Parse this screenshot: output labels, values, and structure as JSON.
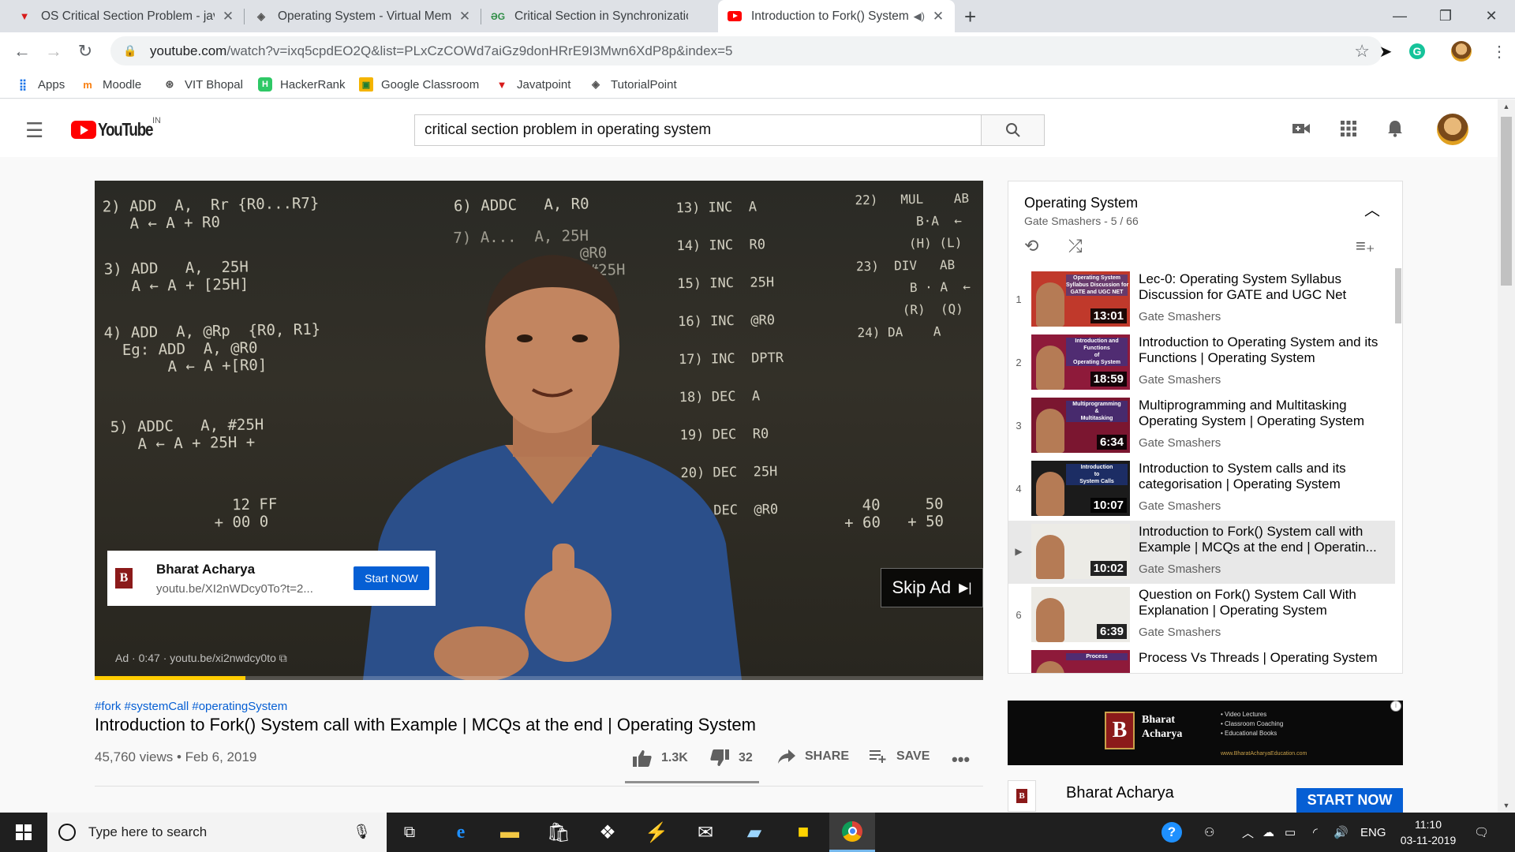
{
  "browser": {
    "tabs": [
      {
        "title": "OS Critical Section Problem - javatpoint",
        "favicon": "javatpoint-icon",
        "color": "#d81b1b"
      },
      {
        "title": "Operating System - Virtual Memory",
        "favicon": "tutorialspoint-icon",
        "color": "#555555"
      },
      {
        "title": "Critical Section in Synchronization",
        "favicon": "geeksforgeeks-icon",
        "color": "#2f8d46"
      },
      {
        "title": "Introduction to Fork() System call",
        "favicon": "youtube-icon",
        "color": "#ff0000",
        "active": true
      }
    ],
    "url_host": "youtube.com",
    "url_path": "/watch?v=ixq5cpdEO2Q&list=PLxCzCOWd7aiGz9donHRrE9I3Mwn6XdP8p&index=5",
    "bookmarks": [
      {
        "label": "Apps",
        "icon": "apps-grid-icon"
      },
      {
        "label": "Moodle",
        "icon": "moodle-icon"
      },
      {
        "label": "VIT Bhopal",
        "icon": "vit-icon"
      },
      {
        "label": "HackerRank",
        "icon": "hackerrank-icon"
      },
      {
        "label": "Google Classroom",
        "icon": "classroom-icon"
      },
      {
        "label": "Javatpoint",
        "icon": "javatpoint-icon"
      },
      {
        "label": "TutorialPoint",
        "icon": "tutorialspoint-icon"
      }
    ]
  },
  "youtube": {
    "logo_text": "YouTube",
    "country": "IN",
    "search_value": "critical section problem in operating system"
  },
  "player": {
    "chalkboard": [
      "2) ADD  A,  Rr {R0...R7}\n   A ← A + R0",
      "3) ADD   A,  25H\n   A ← A + [25H]",
      "4) ADD  A, @Rp  {R0, R1}\n  Eg: ADD  A, @R0\n       A ← A +[R0]",
      "5) ADDC   A, #25H\n   A ← A + 25H +",
      "   12 FF\n + 00 0",
      "6) ADDC   A, R0",
      "7) A...  A, 25H\n              @R0\n            A, #25H\n         25H - CF",
      "13) INC  A\n14) INC  R0\n15) INC  25H\n16) INC  @R0\n17) INC  DPTR\n18) DEC  A\n19) DEC  R0\n20) DEC  25H\n21) DEC  @R0",
      "22)   MUL    AB\n        B·A  ←\n       (H) (L)\n23)  DIV   AB\n       B · A  ←\n      (R)  (Q)\n24) DA    A",
      "  40     50\n+ 60   + 50"
    ],
    "ad_card": {
      "name": "Bharat Acharya",
      "link": "youtu.be/XI2nWDcy0To?t=2...",
      "button": "Start NOW"
    },
    "skip_label": "Skip Ad",
    "ad_bar": "Ad · 0:47 ·  youtu.be/xi2nwdcy0to",
    "progress": 0.17
  },
  "video": {
    "hashtags": "#fork #systemCall #operatingSystem",
    "title": "Introduction to Fork() System call with Example | MCQs at the end | Operating System",
    "stats": "45,760 views • Feb 6, 2019",
    "likes": "1.3K",
    "dislikes": "32",
    "share": "SHARE",
    "save": "SAVE"
  },
  "playlist": {
    "title": "Operating System",
    "subtitle": "Gate Smashers - 5 / 66",
    "items": [
      {
        "index": "1",
        "title": "Lec-0: Operating System Syllabus Discussion for GATE and UGC Net",
        "channel": "Gate Smashers",
        "duration": "13:01",
        "thumb_text": "Operating System\nSyllabus Discussion for\nGATE and UGC NET"
      },
      {
        "index": "2",
        "title": "Introduction to Operating System and its Functions | Operating System",
        "channel": "Gate Smashers",
        "duration": "18:59",
        "thumb_text": "Introduction and\nFunctions\nof\nOperating System"
      },
      {
        "index": "3",
        "title": "Multiprogramming and Multitasking Operating System | Operating System",
        "channel": "Gate Smashers",
        "duration": "6:34",
        "thumb_text": "Multiprogramming\n&\nMultitasking"
      },
      {
        "index": "4",
        "title": "Introduction to System calls and its categorisation | Operating System",
        "channel": "Gate Smashers",
        "duration": "10:07",
        "thumb_text": "Introduction\nto\nSystem Calls"
      },
      {
        "index": "▶",
        "title": "Introduction to Fork() System call with Example | MCQs at the end | Operatin...",
        "channel": "Gate Smashers",
        "duration": "10:02",
        "thumb_text": "",
        "current": true
      },
      {
        "index": "6",
        "title": "Question on Fork() System Call With Explanation | Operating System",
        "channel": "Gate Smashers",
        "duration": "6:39",
        "thumb_text": ""
      },
      {
        "index": "7",
        "title": "Process Vs Threads | Operating System",
        "channel": "Gate Smashers",
        "duration": "",
        "thumb_text": "Process"
      }
    ]
  },
  "side_ad": {
    "brand": "Bharat\nAcharya",
    "bullets": "• Video Lectures\n• Classroom Coaching\n• Educational Books",
    "url": "www.BharatAcharyaEducation.com",
    "name": "Bharat Acharya",
    "button": "START NOW"
  },
  "taskbar": {
    "search_placeholder": "Type here to search",
    "language": "ENG",
    "time": "11:10",
    "date": "03-11-2019"
  }
}
